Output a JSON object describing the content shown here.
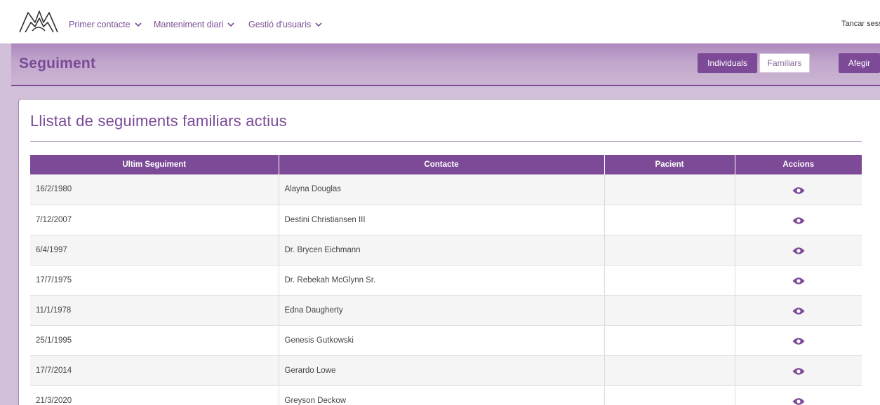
{
  "nav": {
    "menus": [
      {
        "label": "Primer contacte"
      },
      {
        "label": "Manteniment diari"
      },
      {
        "label": "Gestió d'usuaris"
      }
    ],
    "logout": "Tancar sessió"
  },
  "header": {
    "title": "Seguiment",
    "buttons": {
      "individuals": "Individuals",
      "familiars": "Familiars",
      "afegir": "Afegir"
    }
  },
  "card": {
    "title": "Llistat de seguiments familiars actius"
  },
  "table": {
    "columns": [
      "Ultim Seguiment",
      "Contacte",
      "Pacient",
      "Accions"
    ],
    "rows": [
      {
        "date": "16/2/1980",
        "contact": "Alayna Douglas",
        "patient": ""
      },
      {
        "date": "7/12/2007",
        "contact": "Destini Christiansen III",
        "patient": ""
      },
      {
        "date": "6/4/1997",
        "contact": "Dr. Brycen Eichmann",
        "patient": ""
      },
      {
        "date": "17/7/1975",
        "contact": "Dr. Rebekah McGlynn Sr.",
        "patient": ""
      },
      {
        "date": "11/1/1978",
        "contact": "Edna Daugherty",
        "patient": ""
      },
      {
        "date": "25/1/1995",
        "contact": "Genesis Gutkowski",
        "patient": ""
      },
      {
        "date": "17/7/2014",
        "contact": "Gerardo Lowe",
        "patient": ""
      },
      {
        "date": "21/3/2020",
        "contact": "Greyson Deckow",
        "patient": ""
      }
    ],
    "action_icon": "eye-icon"
  },
  "colors": {
    "primary": "#7d4a97",
    "header_band": "#c2a7cc",
    "background": "#d2bfd9"
  }
}
